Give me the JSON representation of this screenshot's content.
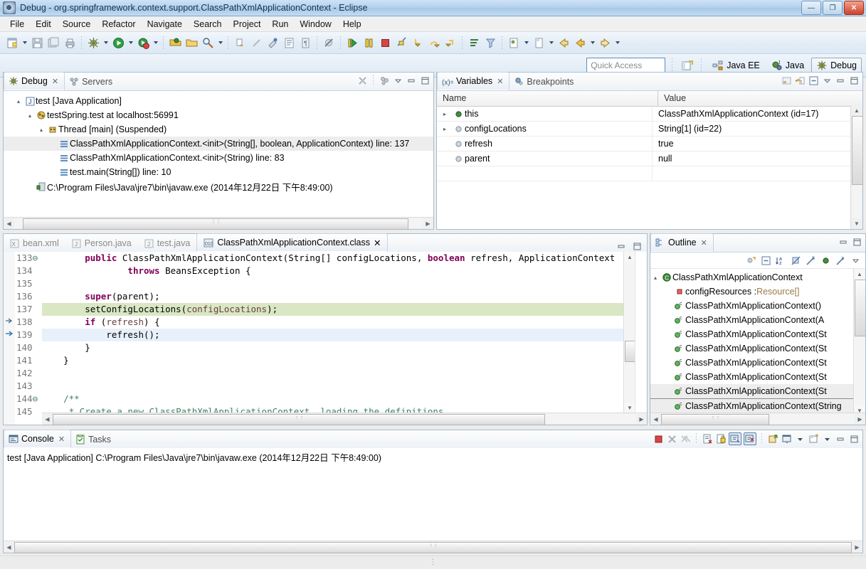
{
  "window": {
    "title": "Debug - org.springframework.context.support.ClassPathXmlApplicationContext - Eclipse",
    "minimize_label": "—",
    "maximize_label": "❐",
    "close_label": "✕"
  },
  "menu": {
    "items": [
      "File",
      "Edit",
      "Source",
      "Refactor",
      "Navigate",
      "Search",
      "Project",
      "Run",
      "Window",
      "Help"
    ]
  },
  "quick_access": {
    "placeholder": "Quick Access",
    "value": ""
  },
  "perspectives": [
    {
      "label": "Java EE",
      "active": false
    },
    {
      "label": "Java",
      "active": false
    },
    {
      "label": "Debug",
      "active": true
    }
  ],
  "debug_view": {
    "tabs": [
      {
        "label": "Debug",
        "selected": true,
        "closable": true
      },
      {
        "label": "Servers",
        "selected": false,
        "closable": false
      }
    ],
    "tree": [
      {
        "indent": 0,
        "twisty": "▴",
        "icon": "java-app-icon",
        "label": "test [Java Application]",
        "selected": false
      },
      {
        "indent": 1,
        "twisty": "▴",
        "icon": "debug-target-icon",
        "label": "testSpring.test at localhost:56991",
        "selected": false
      },
      {
        "indent": 2,
        "twisty": "▴",
        "icon": "thread-icon",
        "label": "Thread [main] (Suspended)",
        "selected": false
      },
      {
        "indent": 3,
        "twisty": "",
        "icon": "stack-frame-icon",
        "label": "ClassPathXmlApplicationContext.<init>(String[], boolean, ApplicationContext) line: 137",
        "selected": true
      },
      {
        "indent": 3,
        "twisty": "",
        "icon": "stack-frame-icon",
        "label": "ClassPathXmlApplicationContext.<init>(String) line: 83",
        "selected": false
      },
      {
        "indent": 3,
        "twisty": "",
        "icon": "stack-frame-icon",
        "label": "test.main(String[]) line: 10",
        "selected": false
      },
      {
        "indent": 1,
        "twisty": "",
        "icon": "process-icon",
        "label": "C:\\Program Files\\Java\\jre7\\bin\\javaw.exe (2014年12月22日 下午8:49:00)",
        "selected": false
      }
    ]
  },
  "variables_view": {
    "tabs": [
      {
        "label": "Variables",
        "selected": true,
        "closable": true
      },
      {
        "label": "Breakpoints",
        "selected": false,
        "closable": false
      }
    ],
    "columns": [
      "Name",
      "Value"
    ],
    "rows": [
      {
        "twisty": "▸",
        "icon": "public-field-icon",
        "name": "this",
        "value": "ClassPathXmlApplicationContext  (id=17)"
      },
      {
        "twisty": "▸",
        "icon": "local-var-icon",
        "name": "configLocations",
        "value": "String[1]  (id=22)"
      },
      {
        "twisty": "",
        "icon": "local-var-icon",
        "name": "refresh",
        "value": "true"
      },
      {
        "twisty": "",
        "icon": "local-var-icon",
        "name": "parent",
        "value": "null"
      }
    ]
  },
  "editor": {
    "tabs": [
      {
        "label": "bean.xml",
        "icon": "xml-file-icon",
        "selected": false
      },
      {
        "label": "Person.java",
        "icon": "java-file-icon",
        "selected": false
      },
      {
        "label": "test.java",
        "icon": "java-file-icon",
        "selected": false
      },
      {
        "label": "ClassPathXmlApplicationContext.class",
        "icon": "class-file-icon",
        "selected": true
      }
    ],
    "lines": [
      {
        "num": "133",
        "fold": "⊖",
        "marker": "",
        "highlight": "none",
        "tokens": [
          {
            "t": "        ",
            "c": "pl"
          },
          {
            "t": "public ",
            "c": "kw"
          },
          {
            "t": "ClassPathXmlApplicationContext(String[] configLocations, ",
            "c": "pl"
          },
          {
            "t": "boolean ",
            "c": "kw"
          },
          {
            "t": "refresh, ApplicationContext",
            "c": "pl"
          }
        ]
      },
      {
        "num": "134",
        "fold": "",
        "marker": "",
        "highlight": "none",
        "tokens": [
          {
            "t": "                ",
            "c": "pl"
          },
          {
            "t": "throws ",
            "c": "kw"
          },
          {
            "t": "BeansException {",
            "c": "pl"
          }
        ]
      },
      {
        "num": "135",
        "fold": "",
        "marker": "",
        "highlight": "none",
        "tokens": []
      },
      {
        "num": "136",
        "fold": "",
        "marker": "arrow-dim",
        "highlight": "none",
        "tokens": [
          {
            "t": "        ",
            "c": "pl"
          },
          {
            "t": "super",
            "c": "kw"
          },
          {
            "t": "(parent);",
            "c": "pl"
          }
        ]
      },
      {
        "num": "137",
        "fold": "",
        "marker": "arrow",
        "highlight": "exec",
        "tokens": [
          {
            "t": "        setConfigLocations(",
            "c": "pl"
          },
          {
            "t": "configLocations",
            "c": "lv"
          },
          {
            "t": ");",
            "c": "pl"
          }
        ]
      },
      {
        "num": "138",
        "fold": "",
        "marker": "",
        "highlight": "none",
        "tokens": [
          {
            "t": "        ",
            "c": "pl"
          },
          {
            "t": "if ",
            "c": "kw"
          },
          {
            "t": "(",
            "c": "pl"
          },
          {
            "t": "refresh",
            "c": "lv"
          },
          {
            "t": ") {",
            "c": "pl"
          }
        ]
      },
      {
        "num": "139",
        "fold": "",
        "marker": "",
        "highlight": "sel",
        "tokens": [
          {
            "t": "            refresh();",
            "c": "pl"
          }
        ]
      },
      {
        "num": "140",
        "fold": "",
        "marker": "",
        "highlight": "none",
        "tokens": [
          {
            "t": "        }",
            "c": "pl"
          }
        ]
      },
      {
        "num": "141",
        "fold": "",
        "marker": "",
        "highlight": "none",
        "tokens": [
          {
            "t": "    }",
            "c": "pl"
          }
        ]
      },
      {
        "num": "142",
        "fold": "",
        "marker": "",
        "highlight": "none",
        "tokens": []
      },
      {
        "num": "143",
        "fold": "",
        "marker": "",
        "highlight": "none",
        "tokens": []
      },
      {
        "num": "144",
        "fold": "⊖",
        "marker": "",
        "highlight": "none",
        "tokens": [
          {
            "t": "    /**",
            "c": "cm"
          }
        ]
      },
      {
        "num": "145",
        "fold": "",
        "marker": "",
        "highlight": "none",
        "tokens": [
          {
            "t": "     * Create a new ClassPathXmlApplicationContext, loading the definitions",
            "c": "cm"
          }
        ]
      }
    ]
  },
  "outline_view": {
    "tab_label": "Outline",
    "items": [
      {
        "indent": 0,
        "twisty": "▴",
        "icon": "class-icon",
        "label": "ClassPathXmlApplicationContext",
        "type": "",
        "selected": false,
        "boxed": false
      },
      {
        "indent": 1,
        "twisty": "",
        "icon": "private-field-icon",
        "label": "configResources : ",
        "type": "Resource[]",
        "selected": false,
        "boxed": false
      },
      {
        "indent": 1,
        "twisty": "",
        "icon": "public-method-icon",
        "label": "ClassPathXmlApplicationContext()",
        "type": "",
        "selected": false,
        "boxed": false
      },
      {
        "indent": 1,
        "twisty": "",
        "icon": "public-method-icon",
        "label": "ClassPathXmlApplicationContext(A",
        "type": "",
        "selected": false,
        "boxed": false
      },
      {
        "indent": 1,
        "twisty": "",
        "icon": "public-method-icon",
        "label": "ClassPathXmlApplicationContext(St",
        "type": "",
        "selected": false,
        "boxed": false
      },
      {
        "indent": 1,
        "twisty": "",
        "icon": "public-method-icon",
        "label": "ClassPathXmlApplicationContext(St",
        "type": "",
        "selected": false,
        "boxed": false
      },
      {
        "indent": 1,
        "twisty": "",
        "icon": "public-method-icon",
        "label": "ClassPathXmlApplicationContext(St",
        "type": "",
        "selected": false,
        "boxed": false
      },
      {
        "indent": 1,
        "twisty": "",
        "icon": "public-method-icon",
        "label": "ClassPathXmlApplicationContext(St",
        "type": "",
        "selected": false,
        "boxed": false
      },
      {
        "indent": 1,
        "twisty": "",
        "icon": "public-method-icon",
        "label": "ClassPathXmlApplicationContext(St",
        "type": "",
        "selected": true,
        "boxed": false
      },
      {
        "indent": 1,
        "twisty": "",
        "icon": "public-method-icon",
        "label": "ClassPathXmlApplicationContext(String",
        "type": "",
        "selected": true,
        "boxed": true
      }
    ]
  },
  "console_view": {
    "tabs": [
      {
        "label": "Console",
        "selected": true,
        "closable": true
      },
      {
        "label": "Tasks",
        "selected": false,
        "closable": false
      }
    ],
    "output": "test [Java Application] C:\\Program Files\\Java\\jre7\\bin\\javaw.exe (2014年12月22日 下午8:49:00)"
  },
  "colors": {
    "exec_line": "#d9e7c4",
    "selected_line": "#e8f0fb",
    "keyword": "#7f0055",
    "comment": "#3f7f5f",
    "local_var": "#6a3e3e",
    "titlebar_from": "#cfe2f6",
    "titlebar_to": "#a8c8e8",
    "panel_border": "#a8bdd0"
  }
}
